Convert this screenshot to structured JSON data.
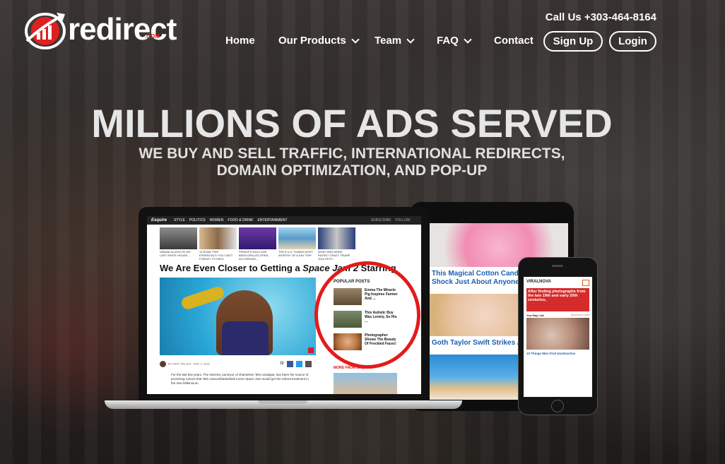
{
  "header": {
    "logo_text": "redirect",
    "logo_suffix": ".COM",
    "call": "Call Us +303-464-8164",
    "nav": [
      {
        "label": "Home",
        "dropdown": false
      },
      {
        "label": "Our Products",
        "dropdown": true
      },
      {
        "label": "Team",
        "dropdown": true
      },
      {
        "label": "FAQ",
        "dropdown": true
      },
      {
        "label": "Contact",
        "dropdown": false
      }
    ],
    "signup_label": "Sign Up",
    "login_label": "Login"
  },
  "hero": {
    "title": "MILLIONS OF ADS SERVED",
    "subtitle_line1": "WE BUY AND SELL TRAFFIC, INTERNATIONAL REDIRECTS,",
    "subtitle_line2": "DOMAIN OPTIMIZATION, AND POP-UP"
  },
  "laptop_site": {
    "brand": "Esquire",
    "menu": [
      "STYLE",
      "POLITICS",
      "WOMEN",
      "FOOD & DRINK",
      "ENTERTAINMENT"
    ],
    "actions": [
      "SUBSCRIBE",
      "FOLLOW"
    ],
    "thumb_captions": [
      "OBAMA SLAYED IN HIS LAST WHITE HOUSE...",
      "13 ROAD TRIP ESSENTIALS YOU CAN'T FORGET TO PACK",
      "PRINCE'S RAST AGE BEEN DRILLED OPEN, ACCORDING...",
      "THE 5 U.S. TOWNS MOST WORTHY OF A DAY TRIP",
      "WHAT WAS MORE RATED? CRAZY TRUMP 2016 SPOT..."
    ],
    "headline": "We Are Even Closer to Getting a ",
    "headline_em": "Space Jam 2",
    "headline_tail": " Starring",
    "byline": "BY MATT MILLER · MAY 2, 2016",
    "share_count": "72",
    "body": "For the last few years, The Internet, purveyor of shameless '90s nostalgia, has been the source of promising rumors that '90s cartoon/basketball movie Space Jam would get the reboot treatment in the new Millennium.",
    "popular_title": "POPULAR POSTS",
    "popular": [
      "Emma The Miracle Pig Inspires Farmer And ...",
      "This Autistic Boy Was Lonely, So His ...",
      "Photographer Shows The Beauty Of Freckled Faces!"
    ],
    "more_label": "MORE FROM ESQUIRE"
  },
  "tablet_site": {
    "caption1": "This Magical Cotton Candy Dessert Shock Just About Anyone",
    "caption2": "Goth Taylor Swift Strikes Again"
  },
  "phone_site": {
    "logo": "VIRALNOVA",
    "banner": "After finding photographs from the late 19th and early 20th centuries,",
    "you_may_like": "You May Like",
    "sponsored": "Sponsored Links",
    "caption": "10 Things Men Find Unattractive"
  },
  "colors": {
    "accent_red": "#e21b1b",
    "link_blue": "#1e5fb4",
    "text_white": "#ffffff"
  }
}
